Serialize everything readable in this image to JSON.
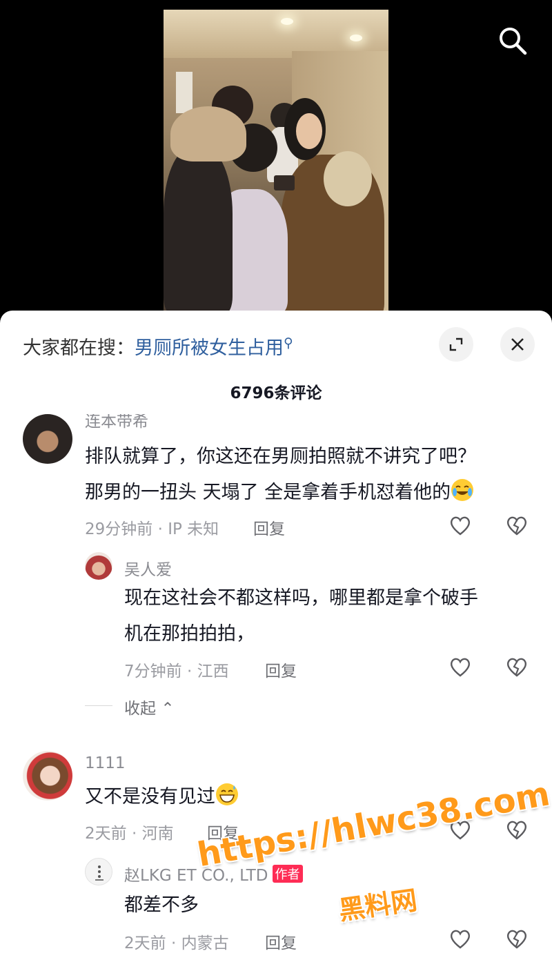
{
  "search_button_icon": "search-icon",
  "sheet": {
    "hot_search_prefix": "大家都在搜：",
    "hot_search_keyword": "男厕所被女生占用",
    "comment_count": "6796条评论"
  },
  "comments": [
    {
      "username": "连本带希",
      "text_line1": "排队就算了，你这还在男厕拍照就不讲究了吧？",
      "text_line2": "那男的一扭头 天塌了 全是拿着手机怼着他的",
      "meta": "29分钟前 · IP 未知",
      "reply_label": "回复"
    },
    {
      "username": "吴人爱",
      "text_line1": "现在这社会不都这样吗，哪里都是拿个破手",
      "text_line2": "机在那拍拍拍，",
      "meta": "7分钟前 · 江西",
      "reply_label": "回复"
    },
    {
      "username": "1111",
      "text_line1": "又不是没有见过",
      "meta": "2天前 · 河南",
      "reply_label": "回复"
    },
    {
      "username": "赵LKG ET CO., LTD",
      "badge": "作者",
      "text_line1": "都差不多",
      "meta": "2天前 · 内蒙古",
      "reply_label": "回复"
    }
  ],
  "collapse_label": "收起",
  "watermark": {
    "url": "https://hlwc38.com",
    "name": "黑料网"
  },
  "colors": {
    "link_blue": "#2f5f9e",
    "text_primary": "#161823",
    "text_secondary": "#8a8b91",
    "watermark_orange": "#ff9a1a",
    "badge_red": "#fe2c55"
  }
}
